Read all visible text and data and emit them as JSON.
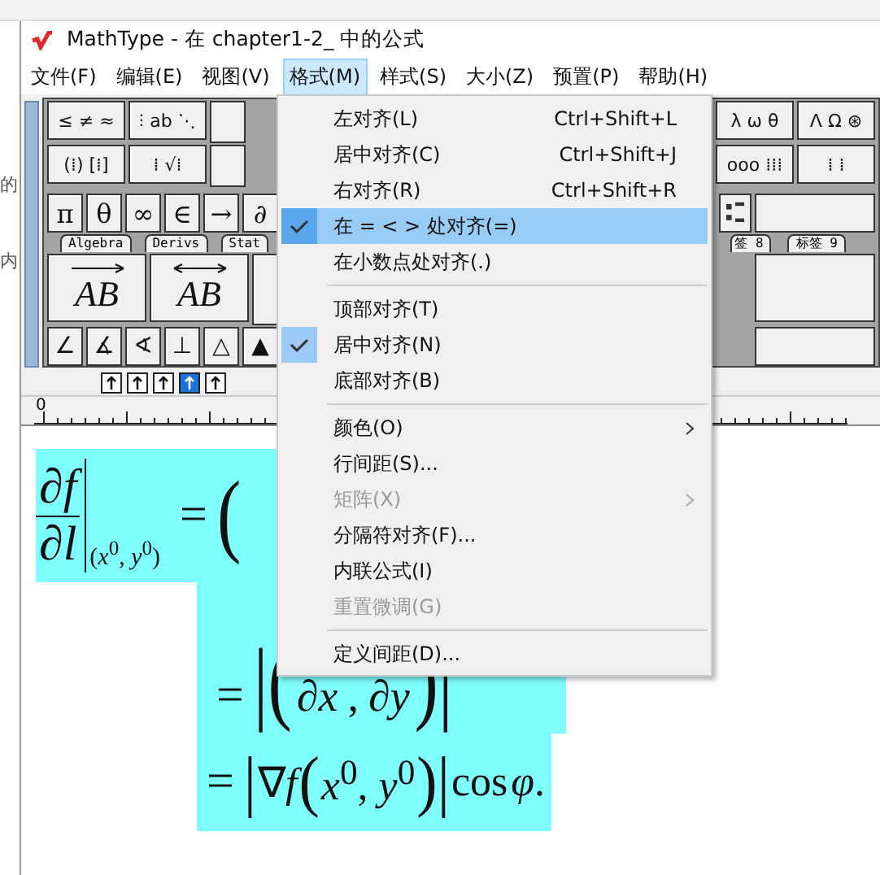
{
  "background": {
    "texts": [
      "的",
      "内"
    ]
  },
  "window": {
    "title": "MathType - 在 chapter1-2_ 中的公式"
  },
  "menubar": [
    {
      "label": "文件(F)",
      "selected": false
    },
    {
      "label": "编辑(E)",
      "selected": false
    },
    {
      "label": "视图(V)",
      "selected": false
    },
    {
      "label": "格式(M)",
      "selected": true
    },
    {
      "label": "样式(S)",
      "selected": false
    },
    {
      "label": "大小(Z)",
      "selected": false
    },
    {
      "label": "预置(P)",
      "selected": false
    },
    {
      "label": "帮助(H)",
      "selected": false
    }
  ],
  "palette": {
    "row_1_left": [
      "≤ ≠ ≈",
      "⫶ ab ⋱"
    ],
    "row_1_right": [
      "λ ω θ",
      "Λ Ω ⊛"
    ],
    "row_2_left": [
      "(⁞) [⁞]",
      "⁞ √⁞"
    ],
    "row_2_right": [
      "ooo ⁞⁞⁞",
      "⁞ ⁞"
    ],
    "row_3_left": [
      "π",
      "θ",
      "∞",
      "∈",
      "→",
      "∂"
    ],
    "tabs_left": [
      "Algebra",
      "Derivs",
      "Stat"
    ],
    "tabs_right": [
      "签 8",
      "标签 9"
    ],
    "templates": [
      {
        "kind": "right-arrow",
        "label": "AB"
      },
      {
        "kind": "double-arrow",
        "label": "AB"
      }
    ],
    "row_4_left": [
      "∠",
      "∡",
      "∢",
      "⊥",
      "△",
      "▲"
    ]
  },
  "nudge": [
    {
      "selected": false
    },
    {
      "selected": false
    },
    {
      "selected": false
    },
    {
      "selected": true
    },
    {
      "selected": false
    }
  ],
  "ruler": {
    "zero": "0"
  },
  "equation": {
    "lines": [
      {
        "parts": [
          {
            "kind": "frac",
            "num": "∂*f*",
            "den": "∂*l*"
          },
          {
            "kind": "eval",
            "text": "(*x*$^{0}$, *y*$^{0}$)"
          },
          {
            "kind": "op",
            "text": "="
          },
          {
            "kind": "big",
            "text": "("
          }
        ]
      },
      {
        "parts": [
          {
            "kind": "op",
            "text": "="
          },
          {
            "kind": "big",
            "text": "|"
          },
          {
            "kind": "big",
            "text": "("
          },
          {
            "kind": "low",
            "text": "∂*x*"
          },
          {
            "kind": "low",
            "text": ","
          },
          {
            "kind": "low",
            "text": "∂*y*"
          },
          {
            "kind": "big",
            "text": ")"
          },
          {
            "kind": "big",
            "text": "|"
          }
        ]
      },
      {
        "parts": [
          {
            "kind": "op",
            "text": "="
          },
          {
            "kind": "big",
            "text": "|"
          },
          {
            "kind": "math",
            "text": "∇*f*"
          },
          {
            "kind": "big",
            "text": "("
          },
          {
            "kind": "math",
            "text": "*x*$^{0}$, *y*$^{0}$"
          },
          {
            "kind": "big",
            "text": ")"
          },
          {
            "kind": "big",
            "text": "|"
          },
          {
            "kind": "math",
            "text": "cos"
          },
          {
            "kind": "math",
            "text": "*φ*."
          }
        ]
      }
    ]
  },
  "menu": {
    "items": [
      {
        "kind": "item",
        "label": "左对齐(L)",
        "shortcut": "Ctrl+Shift+L",
        "checked": false,
        "selected": false,
        "disabled": false,
        "submenu": false
      },
      {
        "kind": "item",
        "label": "居中对齐(C)",
        "shortcut": "Ctrl+Shift+J",
        "checked": false,
        "selected": false,
        "disabled": false,
        "submenu": false
      },
      {
        "kind": "item",
        "label": "右对齐(R)",
        "shortcut": "Ctrl+Shift+R",
        "checked": false,
        "selected": false,
        "disabled": false,
        "submenu": false
      },
      {
        "kind": "item",
        "label": "在 = < > 处对齐(=)",
        "checked": true,
        "selected": true,
        "disabled": false,
        "submenu": false
      },
      {
        "kind": "item",
        "label": "在小数点处对齐(.)",
        "checked": false,
        "selected": false,
        "disabled": false,
        "submenu": false
      },
      {
        "kind": "separator"
      },
      {
        "kind": "item",
        "label": "顶部对齐(T)",
        "checked": false,
        "selected": false,
        "disabled": false,
        "submenu": false
      },
      {
        "kind": "item",
        "label": "居中对齐(N)",
        "checked": true,
        "selected": false,
        "disabled": false,
        "submenu": false
      },
      {
        "kind": "item",
        "label": "底部对齐(B)",
        "checked": false,
        "selected": false,
        "disabled": false,
        "submenu": false
      },
      {
        "kind": "separator"
      },
      {
        "kind": "item",
        "label": "颜色(O)",
        "checked": false,
        "selected": false,
        "disabled": false,
        "submenu": true
      },
      {
        "kind": "item",
        "label": "行间距(S)...",
        "checked": false,
        "selected": false,
        "disabled": false,
        "submenu": false
      },
      {
        "kind": "item",
        "label": "矩阵(X)",
        "checked": false,
        "selected": false,
        "disabled": true,
        "submenu": true
      },
      {
        "kind": "item",
        "label": "分隔符对齐(F)...",
        "checked": false,
        "selected": false,
        "disabled": false,
        "submenu": false
      },
      {
        "kind": "item",
        "label": "内联公式(I)",
        "checked": false,
        "selected": false,
        "disabled": false,
        "submenu": false
      },
      {
        "kind": "item",
        "label": "重置微调(G)",
        "checked": false,
        "selected": false,
        "disabled": true,
        "submenu": false
      },
      {
        "kind": "separator"
      },
      {
        "kind": "item",
        "label": "定义间距(D)...",
        "checked": false,
        "selected": false,
        "disabled": false,
        "submenu": false
      }
    ]
  }
}
